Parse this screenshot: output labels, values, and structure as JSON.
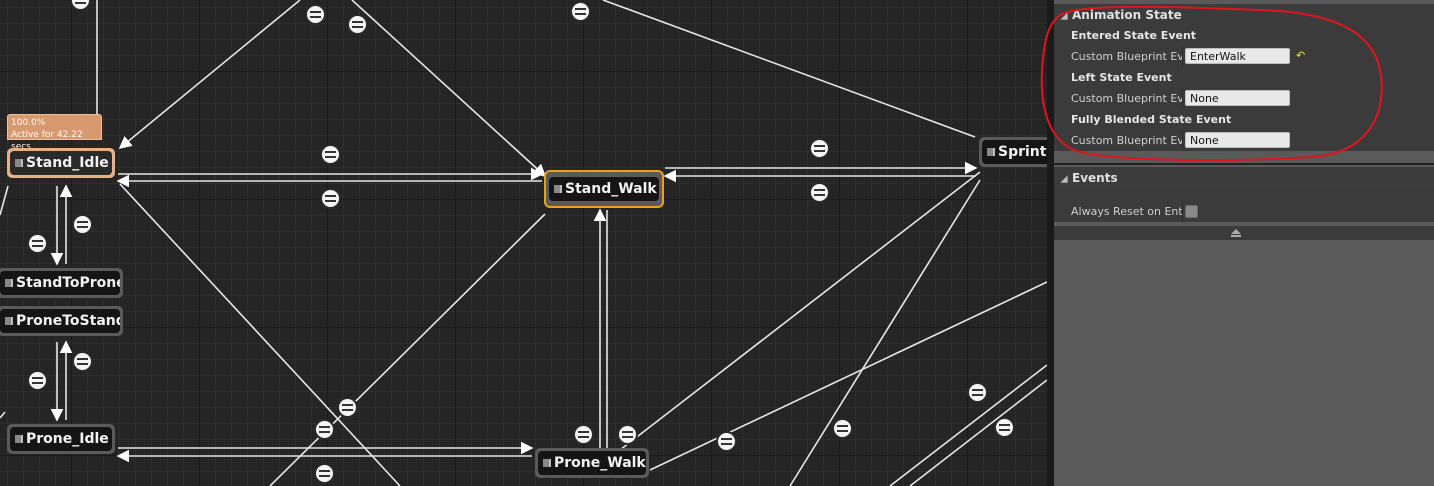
{
  "graph": {
    "tooltip": {
      "percent": "100.0%",
      "active": "Active for 42.22 secs"
    },
    "nodes": {
      "stand_idle": "Stand_Idle",
      "stand_walk": "Stand_Walk",
      "sprint": "Sprint",
      "stand_to_prone": "StandToProne",
      "prone_to_stand": "ProneToStand",
      "prone_idle": "Prone_Idle",
      "prone_walk": "Prone_Walk"
    }
  },
  "details": {
    "animation_state": {
      "header": "Animation State",
      "entered_group": "Entered State Event",
      "entered_label": "Custom Blueprint Event",
      "entered_value": "EnterWalk",
      "left_group": "Left State Event",
      "left_label": "Custom Blueprint Event",
      "left_value": "None",
      "blended_group": "Fully Blended State Event",
      "blended_label": "Custom Blueprint Event",
      "blended_value": "None"
    },
    "events": {
      "header": "Events",
      "always_reset_label": "Always Reset on Entry",
      "always_reset_checked": false
    }
  },
  "colors": {
    "active_node": "#e6b08a",
    "selected_outline": "#e8a21a",
    "annotation": "#e0141e"
  }
}
